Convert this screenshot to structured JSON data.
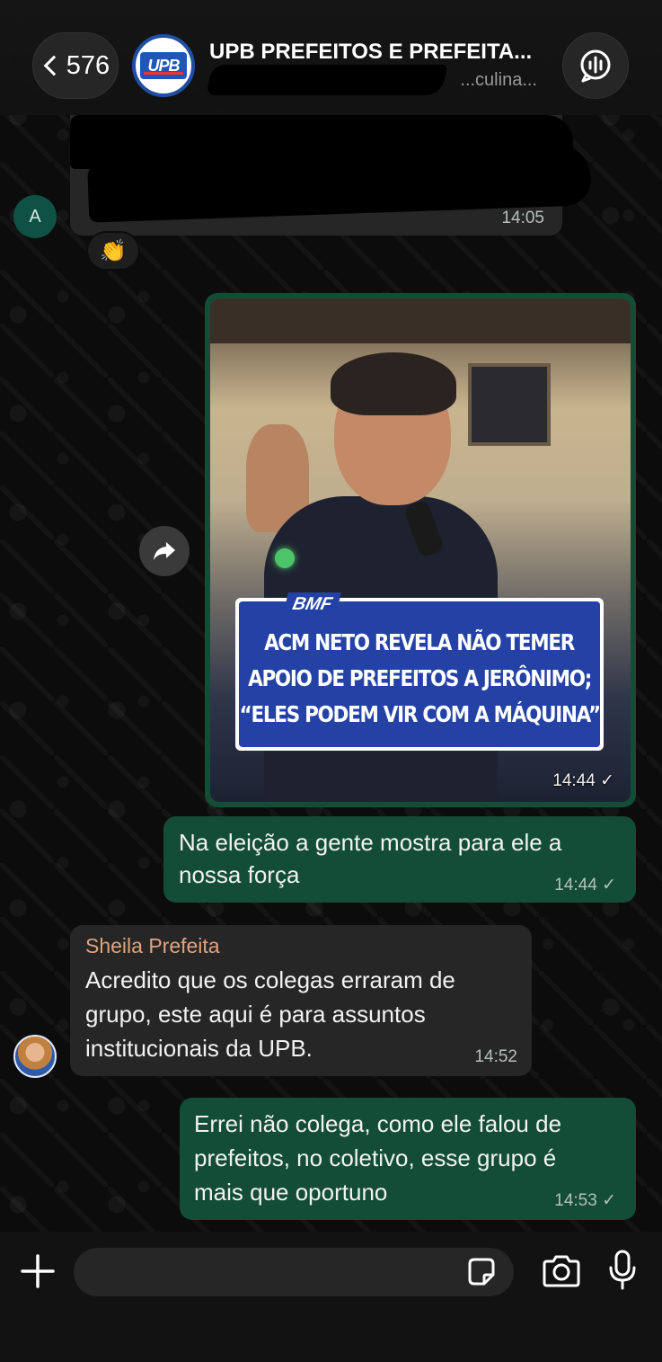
{
  "header": {
    "back_count": "576",
    "group_title": "UPB PREFEITOS E PREFEITA...",
    "group_subtitle": "...culina...",
    "avatar_logo_text": "UPB"
  },
  "messages": {
    "first": {
      "sender_initial": "A",
      "time": "14:05",
      "reaction": "👏"
    },
    "media": {
      "banner_tag": "BMF",
      "headline_lines": [
        "ACM NETO REVELA NÃO TEMER",
        "APOIO DE PREFEITOS A JERÔNIMO;",
        "“ELES PODEM VIR COM A MÁQUINA”"
      ],
      "time": "14:44 ✓"
    },
    "out1": {
      "text_line1": "Na eleição a gente mostra para ele a",
      "text_line2": "nossa força",
      "time": "14:44 ✓"
    },
    "in1": {
      "sender": "Sheila Prefeita",
      "text_line1": "Acredito que os colegas erraram de",
      "text_line2": "grupo, este aqui é para assuntos",
      "text_line3": "institucionais da UPB.",
      "time": "14:52"
    },
    "out2": {
      "text_line1": "Errei não colega, como ele falou de",
      "text_line2": "prefeitos, no coletivo, esse grupo é",
      "text_line3": "mais que oportuno",
      "time": "14:53 ✓"
    }
  },
  "composer": {
    "input_value": "",
    "input_placeholder": ""
  },
  "colors": {
    "outgoing_bubble": "#134d37",
    "incoming_bubble": "#262626",
    "sender_name": "#e0a47c",
    "background": "#0c0c0c"
  },
  "icons": [
    "chevron-left-icon",
    "call-waveform-icon",
    "forward-icon",
    "plus-icon",
    "sticker-icon",
    "camera-icon",
    "microphone-icon"
  ]
}
